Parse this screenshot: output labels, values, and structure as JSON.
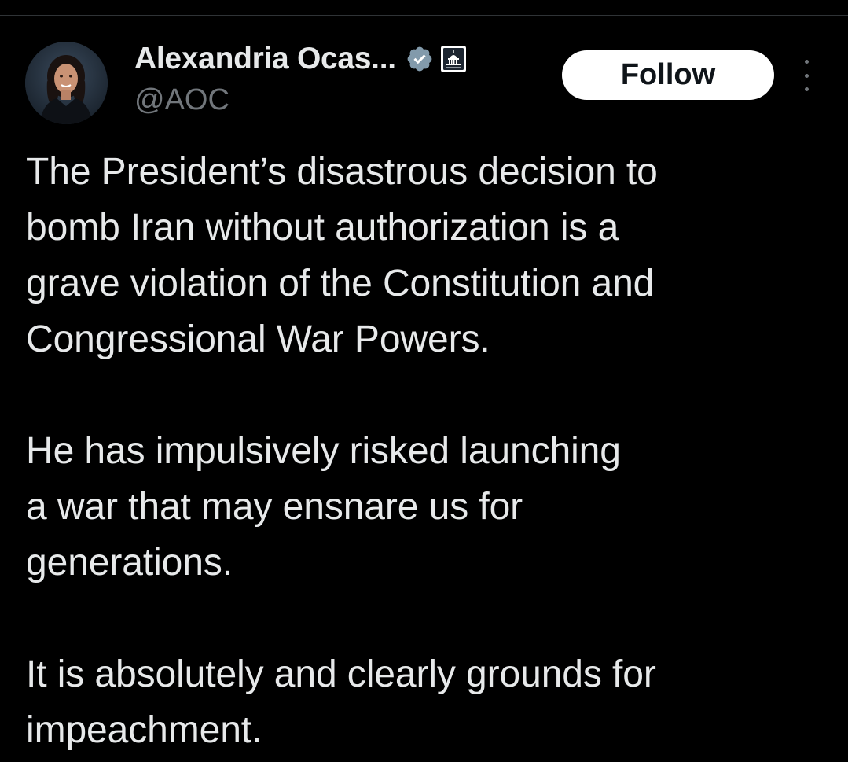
{
  "author": {
    "display_name": "Alexandria Ocas...",
    "handle": "@AOC",
    "verified_icon": "verified-badge-icon",
    "affiliation_icon": "government-capitol-badge-icon"
  },
  "actions": {
    "follow_label": "Follow",
    "more_icon": "more-options-icon"
  },
  "tweet": {
    "paragraphs": [
      "The President’s disastrous decision to\nbomb Iran without authorization is a\ngrave violation of the Constitution and\nCongressional War Powers.",
      "He has impulsively risked launching\na war that may ensnare us for\ngenerations.",
      "It is absolutely and clearly grounds for\nimpeachment."
    ]
  },
  "colors": {
    "background": "#000000",
    "primary_text": "#e7e9ea",
    "secondary_text": "#71767b",
    "verified": "#829aab",
    "follow_bg": "#ffffff"
  }
}
